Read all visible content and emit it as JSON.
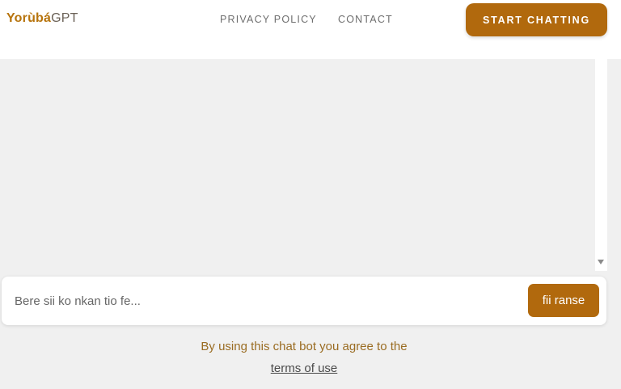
{
  "header": {
    "logo_brand": "Yorùbá",
    "logo_suffix": "GPT",
    "nav": [
      {
        "label": "PRIVACY POLICY"
      },
      {
        "label": "CONTACT"
      }
    ],
    "cta_label": "START CHATTING"
  },
  "composer": {
    "placeholder": "Bere sii ko nkan tio fe...",
    "value": "",
    "send_label": "fii ranse"
  },
  "footer": {
    "agreement_text": "By using this chat bot you agree to the",
    "terms_link": "terms of use"
  },
  "colors": {
    "accent": "#b1690d",
    "brand": "#b7740d",
    "agreement_text": "#9a6c22",
    "background": "#f0f0f0"
  }
}
